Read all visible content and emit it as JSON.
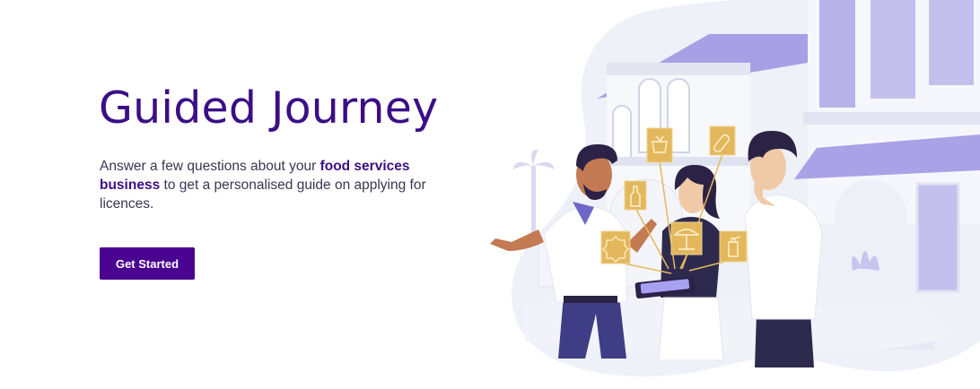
{
  "hero": {
    "title": "Guided Journey",
    "description_before": "Answer a few questions about your ",
    "description_highlight": "food services business",
    "description_after": " to get a personalised guide on applying for licences.",
    "cta_label": "Get Started"
  },
  "colors": {
    "primary": "#3a0f86",
    "button": "#4a0390",
    "text": "#3d3550",
    "illustration_lavender": "#b2aaec",
    "icon_gold": "#e3b85c"
  },
  "illustration": {
    "icons": [
      "license-icon",
      "bottle-icon",
      "grocery-icon",
      "pills-icon",
      "outdoor-dining-icon",
      "fire-extinguisher-icon"
    ]
  }
}
